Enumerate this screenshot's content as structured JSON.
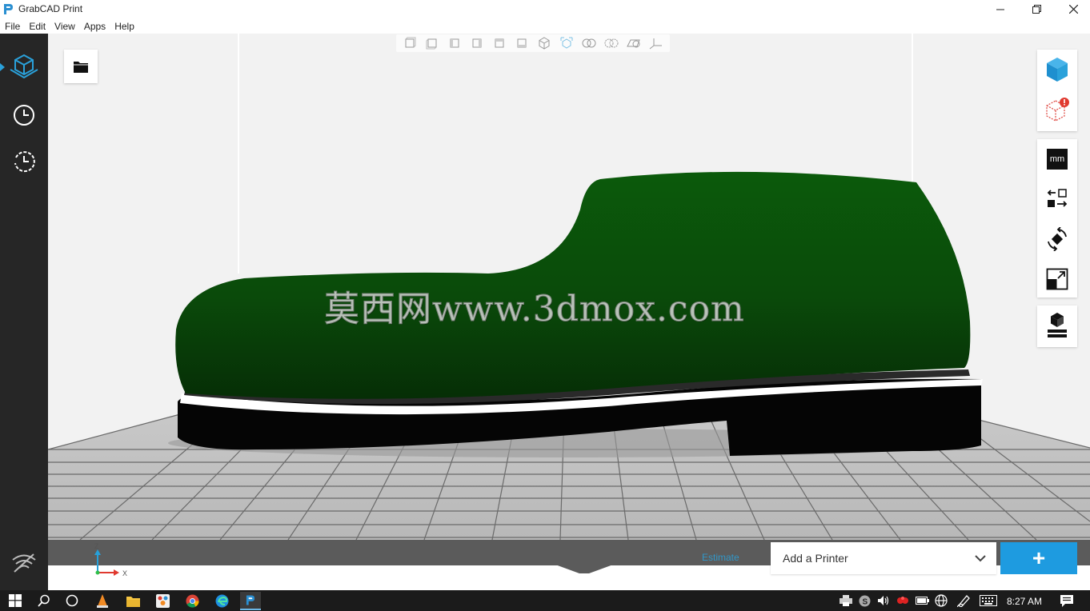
{
  "window": {
    "title": "GrabCAD Print",
    "controls": [
      "minimize-icon",
      "restore-icon",
      "close-icon"
    ]
  },
  "menu": [
    "File",
    "Edit",
    "View",
    "Apps",
    "Help"
  ],
  "sidebar": {
    "items": [
      {
        "icon": "model-view-icon",
        "active": true
      },
      {
        "icon": "clock-icon",
        "active": false
      },
      {
        "icon": "history-icon",
        "active": false
      },
      {
        "icon": "wifi-off-icon",
        "active": false
      }
    ]
  },
  "view_toolbar": {
    "buttons": [
      "front-view-icon",
      "back-view-icon",
      "left-view-icon",
      "right-view-icon",
      "top-view-icon",
      "bottom-view-icon",
      "iso-view-icon",
      "fit-view-icon",
      "zoom-icon",
      "zoom-area-icon",
      "zoom-fit-icon",
      "axis-icon"
    ]
  },
  "right_panel": {
    "group1": [
      "model-cube-icon",
      "model-error-icon"
    ],
    "units_label": "mm",
    "group2": [
      "arrange-icon",
      "rotate-icon",
      "scale-icon"
    ],
    "group3": [
      "print-settings-icon"
    ]
  },
  "watermark": "莫西网www.3dmox.com",
  "axis": {
    "z": "Z",
    "x": "X"
  },
  "bottom": {
    "estimate_label": "Estimate",
    "printer_select": "Add a Printer",
    "add_button": "+"
  },
  "taskbar": {
    "time": "8:27 AM"
  },
  "colors": {
    "accent": "#1e9be0",
    "sidebar": "#262626",
    "shoe_upper": "#0a4a0a",
    "shoe_sole": "#050505"
  }
}
